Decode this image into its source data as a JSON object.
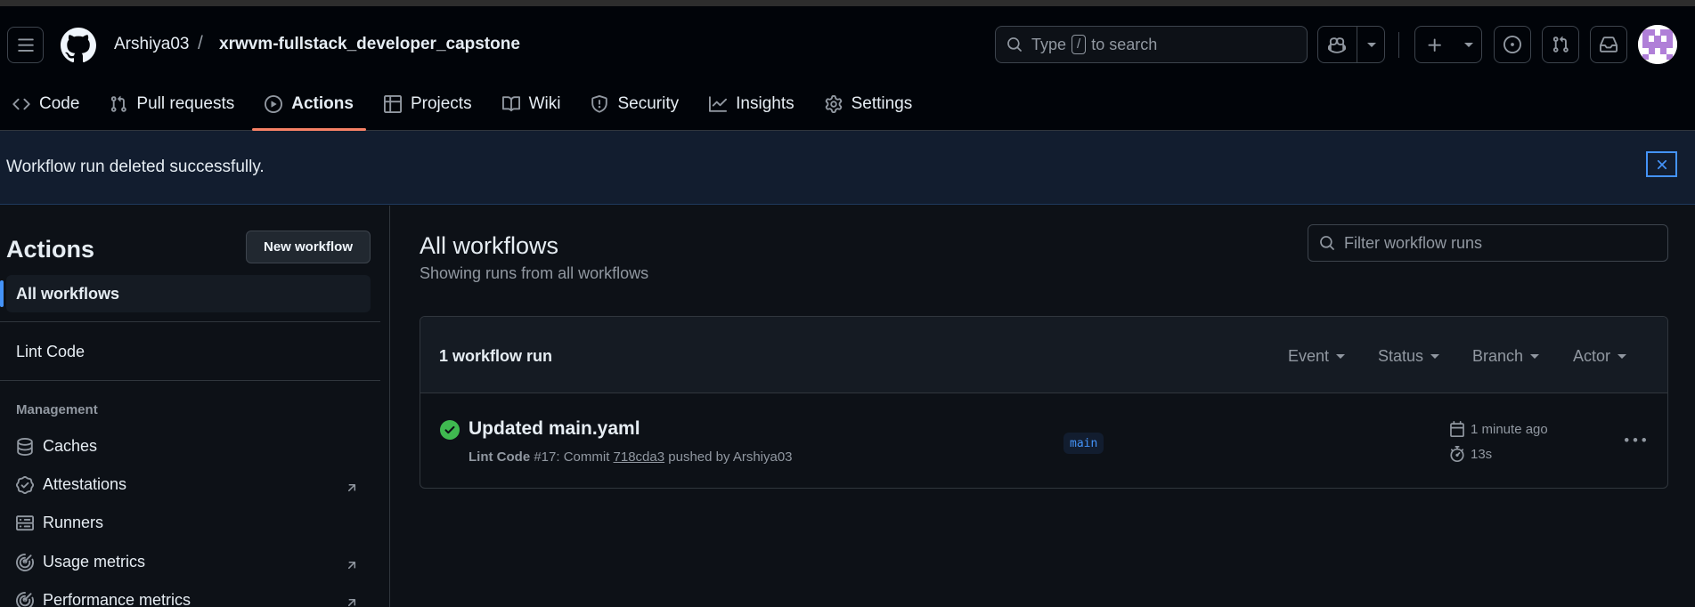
{
  "header": {
    "owner": "Arshiya03",
    "separator": "/",
    "repo": "xrwvm-fullstack_developer_capstone",
    "search": {
      "prefix": "Type",
      "key": "/",
      "suffix": "to search"
    },
    "icons": {
      "menu": "hamburger-icon",
      "logo": "github-logo",
      "copilot": "copilot-icon",
      "plus": "plus-icon",
      "issues": "issue-opened-icon",
      "pulls": "git-pull-request-icon",
      "inbox": "inbox-icon"
    }
  },
  "tabs": [
    {
      "label": "Code",
      "icon": "code-icon"
    },
    {
      "label": "Pull requests",
      "icon": "git-pull-request-icon"
    },
    {
      "label": "Actions",
      "icon": "play-icon",
      "active": true
    },
    {
      "label": "Projects",
      "icon": "table-icon"
    },
    {
      "label": "Wiki",
      "icon": "book-icon"
    },
    {
      "label": "Security",
      "icon": "shield-icon"
    },
    {
      "label": "Insights",
      "icon": "graph-icon"
    },
    {
      "label": "Settings",
      "icon": "gear-icon"
    }
  ],
  "flash": {
    "message": "Workflow run deleted successfully."
  },
  "sidebar": {
    "title": "Actions",
    "new_workflow": "New workflow",
    "all_workflows": "All workflows",
    "workflows": [
      "Lint Code"
    ],
    "management_heading": "Management",
    "management": [
      {
        "label": "Caches",
        "icon": "database-icon"
      },
      {
        "label": "Attestations",
        "icon": "verified-icon",
        "external": true
      },
      {
        "label": "Runners",
        "icon": "server-icon"
      },
      {
        "label": "Usage metrics",
        "icon": "meter-icon",
        "external": true
      },
      {
        "label": "Performance metrics",
        "icon": "meter-icon",
        "external": true
      }
    ]
  },
  "main": {
    "title": "All workflows",
    "subtitle": "Showing runs from all workflows",
    "filter_placeholder": "Filter workflow runs",
    "runs_count": "1 workflow run",
    "filters": [
      "Event",
      "Status",
      "Branch",
      "Actor"
    ],
    "run": {
      "title": "Updated main.yaml",
      "workflow": "Lint Code",
      "number": "#17",
      "commit_prefix": ": Commit",
      "sha": "718cda3",
      "pushed_by": "pushed by Arshiya03",
      "branch": "main",
      "time": "1 minute ago",
      "duration": "13s",
      "status": "success"
    }
  },
  "colors": {
    "background": "#0d1117",
    "header": "#010409",
    "accent": "#4493f8",
    "active_tab": "#f78166",
    "success": "#3fb950",
    "flash_bg": "#121d2f"
  }
}
